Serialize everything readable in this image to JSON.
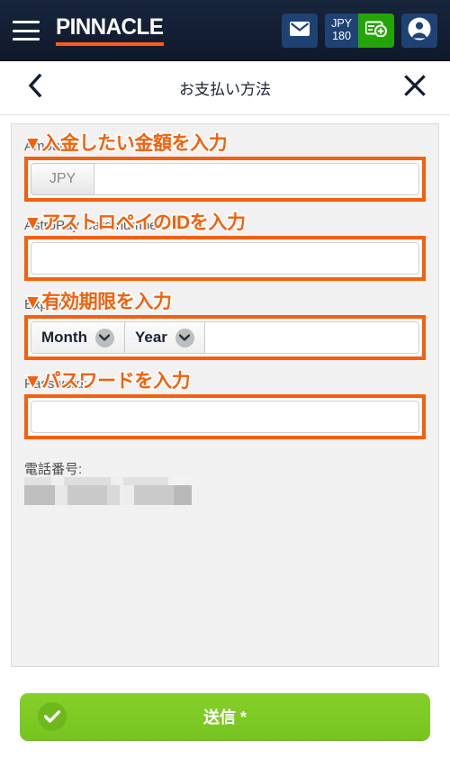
{
  "topbar": {
    "menu_icon": "hamburger-icon",
    "brand": "PINNACLE",
    "mail_icon": "envelope-icon",
    "balance": {
      "currency": "JPY",
      "amount": "180"
    },
    "deposit_icon": "deposit-card-plus-icon",
    "account_icon": "user-avatar-icon",
    "accent_color": "#ff5b1a",
    "deposit_color": "#24a507",
    "chip_color": "#1e4273"
  },
  "titlebar": {
    "back_icon": "chevron-left-icon",
    "title": "お支払い方法",
    "close_icon": "close-x-icon"
  },
  "form": {
    "annotation_color": "#f4600c",
    "fields": [
      {
        "annotation": "▼入金したい金額を入力",
        "ghost_label": "Amount:",
        "prefix": "JPY",
        "value": "",
        "placeholder": ""
      },
      {
        "annotation": "▼アストロペイのIDを入力",
        "ghost_label": "AstroPay Card number:",
        "value": "",
        "placeholder": ""
      },
      {
        "annotation": "▼有効期限を入力",
        "ghost_label": "Expiry date:",
        "month_label": "Month",
        "year_label": "Year",
        "chevron_icon": "chevron-down-icon"
      },
      {
        "annotation": "▼パスワードを入力",
        "ghost_label": "Password:",
        "value": "",
        "placeholder": ""
      }
    ],
    "phone": {
      "label": "電話番号:",
      "value": ""
    }
  },
  "submit": {
    "label": "送信 *",
    "icon": "check-circle-icon",
    "color": "#7bc723"
  }
}
